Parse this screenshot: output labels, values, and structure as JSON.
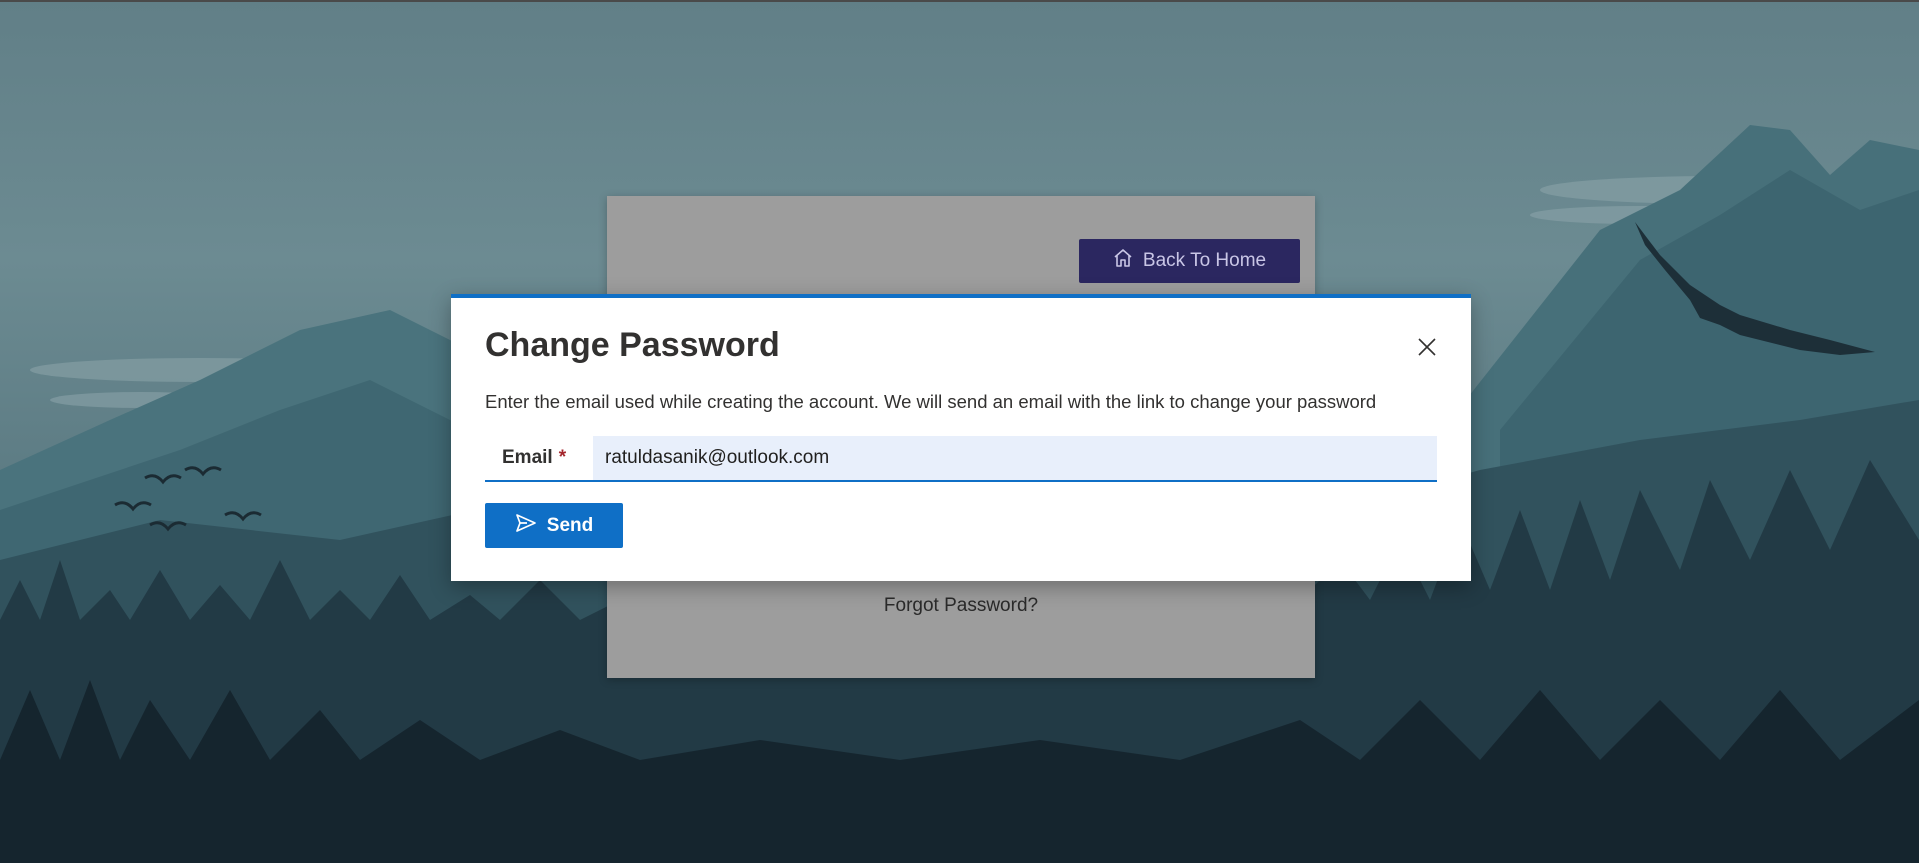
{
  "background": {
    "scene": "misty mountains with pine forest and flying birds"
  },
  "login_card": {
    "back_home_label": "Back To Home",
    "back_home_icon": "home-icon",
    "forgot_password_label": "Forgot Password?"
  },
  "dialog": {
    "title": "Change Password",
    "close_icon": "close-icon",
    "description": "Enter the email used while creating the account. We will send an email with the link to change your password",
    "email_label": "Email",
    "required_mark": "*",
    "email_value": "ratuldasanik@outlook.com",
    "send_label": "Send",
    "send_icon": "send-icon"
  },
  "colors": {
    "accent": "#0f6fc6",
    "back_home_bg": "#2b2760",
    "input_bg": "#e8effb",
    "card_overlay": "#9d9d9d"
  }
}
